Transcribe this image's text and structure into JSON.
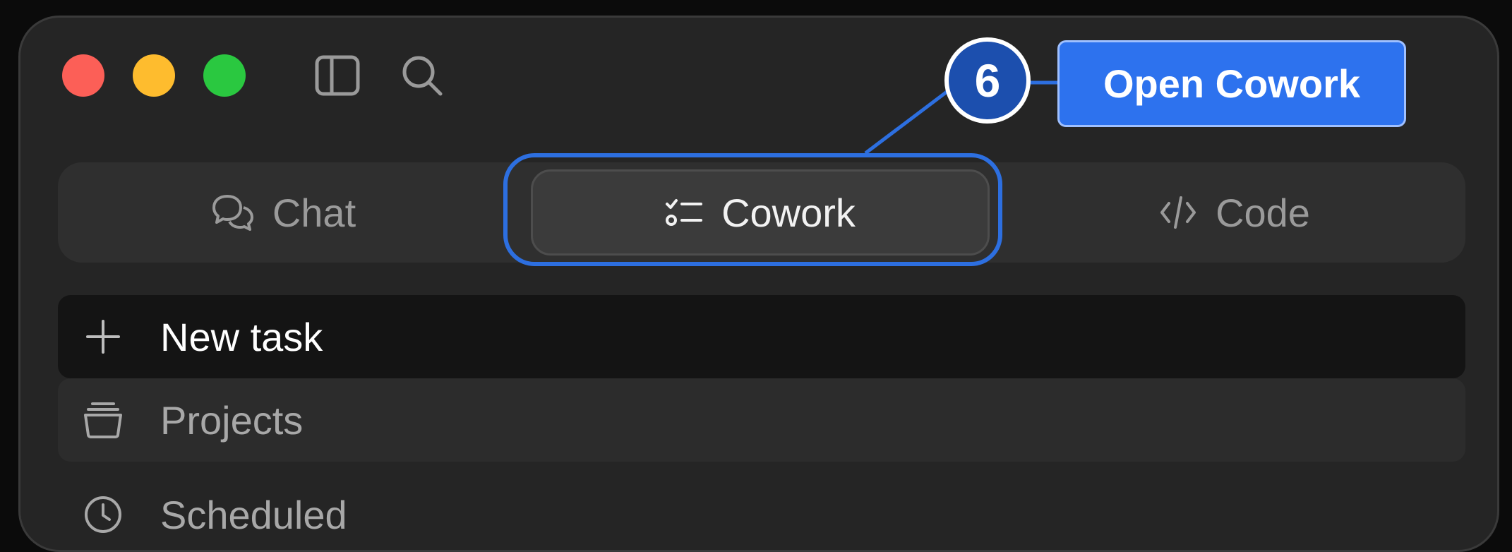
{
  "window": {
    "controls": [
      "close",
      "minimize",
      "zoom"
    ]
  },
  "toolbar": {
    "sidebar_icon": "sidebar-icon",
    "search_icon": "search-icon"
  },
  "tabs": [
    {
      "label": "Chat",
      "icon": "chat-bubbles-icon",
      "selected": false
    },
    {
      "label": "Cowork",
      "icon": "checklist-icon",
      "selected": true
    },
    {
      "label": "Code",
      "icon": "code-brackets-icon",
      "selected": false
    }
  ],
  "annotation": {
    "step_number": "6",
    "callout_label": "Open Cowork",
    "color": "#2d72ee"
  },
  "sidebar": {
    "items": [
      {
        "label": "New task",
        "icon": "plus-icon"
      },
      {
        "label": "Projects",
        "icon": "projects-stack-icon"
      },
      {
        "label": "Scheduled",
        "icon": "clock-icon"
      }
    ]
  }
}
